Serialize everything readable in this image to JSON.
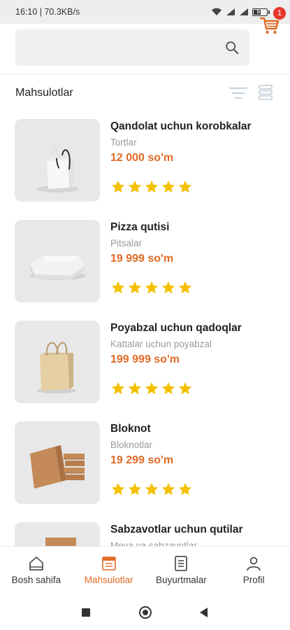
{
  "status_bar": {
    "time_speed": "16:10 | 70.3KB/s",
    "battery_level": "57",
    "battery_fraction": 0.57
  },
  "search": {
    "placeholder": "",
    "value": ""
  },
  "cart": {
    "badge_count": "1",
    "accent_color": "#e16a26",
    "badge_color": "#e8362b"
  },
  "section": {
    "title": "Mahsulotlar"
  },
  "products": [
    {
      "name": "Qandolat uchun korobkalar",
      "category": "Tortlar",
      "price": "12 000 so'm",
      "rating": 5,
      "image": "white-gift-bag"
    },
    {
      "name": "Pizza qutisi",
      "category": "Pitsalar",
      "price": "19 999 so'm",
      "rating": 5,
      "image": "white-pizza-box"
    },
    {
      "name": "Poyabzal uchun qadoqlar",
      "category": "Kattalar uchun poyabzal",
      "price": "199 999 so'm",
      "rating": 5,
      "image": "kraft-paper-bag"
    },
    {
      "name": "Bloknot",
      "category": "Bloknotlar",
      "price": "19 299 so'm",
      "rating": 5,
      "image": "kraft-box-stack"
    },
    {
      "name": "Sabzavotlar uchun qutilar",
      "category": "Meva va sabzavotlar",
      "price": "",
      "rating": 0,
      "image": "kraft-box"
    }
  ],
  "bottom_nav": [
    {
      "label": "Bosh sahifa",
      "icon": "home-icon",
      "active": false
    },
    {
      "label": "Mahsulotlar",
      "icon": "catalog-icon",
      "active": true
    },
    {
      "label": "Buyurtmalar",
      "icon": "orders-icon",
      "active": false
    },
    {
      "label": "Profil",
      "icon": "profile-icon",
      "active": false
    }
  ],
  "colors": {
    "star": "#f5c000",
    "price": "#e16a26"
  }
}
